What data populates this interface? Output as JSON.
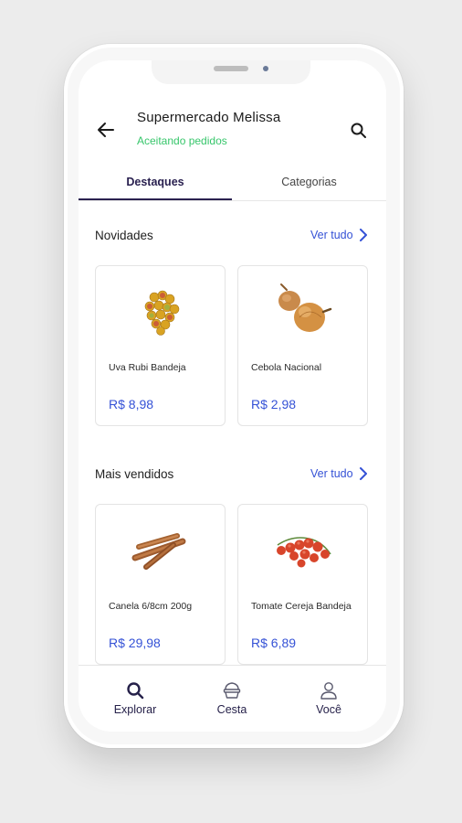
{
  "header": {
    "store_name": "Supermercado Melissa",
    "status": "Aceitando pedidos",
    "back_icon": "arrow-left-icon",
    "search_icon": "search-icon"
  },
  "tabs": [
    {
      "label": "Destaques",
      "active": true
    },
    {
      "label": "Categorias",
      "active": false
    }
  ],
  "sections": [
    {
      "title": "Novidades",
      "see_all": "Ver tudo",
      "products": [
        {
          "name": "Uva Rubi Bandeja",
          "price": "R$ 8,98",
          "image": "grapes"
        },
        {
          "name": "Cebola Nacional",
          "price": "R$ 2,98",
          "image": "onion"
        }
      ]
    },
    {
      "title": "Mais vendidos",
      "see_all": "Ver tudo",
      "products": [
        {
          "name": "Canela 6/8cm 200g",
          "price": "R$ 29,98",
          "image": "cinnamon"
        },
        {
          "name": "Tomate Cereja Bandeja",
          "price": "R$ 6,89",
          "image": "cherry-tomato"
        }
      ]
    }
  ],
  "bottom_nav": [
    {
      "label": "Explorar",
      "icon": "search-icon"
    },
    {
      "label": "Cesta",
      "icon": "basket-icon"
    },
    {
      "label": "Você",
      "icon": "user-icon"
    }
  ],
  "colors": {
    "accent": "#3552d6",
    "status_green": "#37c66b",
    "tab_active": "#2a2150"
  }
}
